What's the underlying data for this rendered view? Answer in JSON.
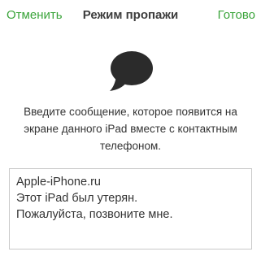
{
  "navbar": {
    "cancel_label": "Отменить",
    "title": "Режим пропажи",
    "done_label": "Готово"
  },
  "icon": {
    "name": "speech-bubble-icon",
    "color": "#2b2b2b"
  },
  "info": {
    "text": "Введите сообщение, которое появится на экране данного iPad вместе с контактным телефоном."
  },
  "message": {
    "lines": [
      "Apple-iPhone.ru",
      "Этот iPad был утерян.",
      "Пожалуйста, позвоните мне."
    ]
  },
  "colors": {
    "accent": "#3aa43a",
    "text": "#333333",
    "border": "#c9c9c9"
  }
}
